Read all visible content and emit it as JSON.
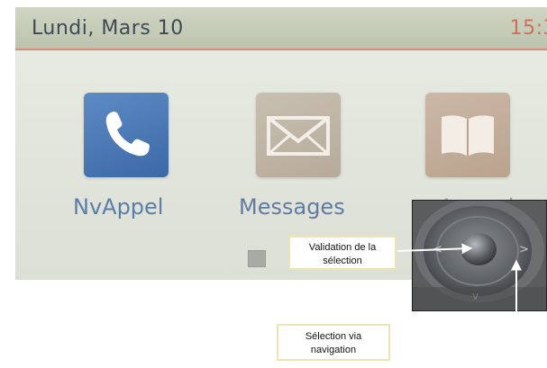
{
  "status_bar": {
    "date": "Lundi, Mars 10",
    "time": "15:3"
  },
  "apps": [
    {
      "label": "NvAppel",
      "icon": "phone-icon",
      "color": "#3b69a6"
    },
    {
      "label": "Messages",
      "icon": "envelope-icon",
      "color": "#b6ab9b"
    },
    {
      "label": "Annuaire",
      "icon": "book-icon",
      "color": "#b9a38e"
    }
  ],
  "pager": {
    "current_page": 1
  },
  "callouts": {
    "validate": {
      "line1": "Validation de la",
      "line2": "sélection"
    },
    "navigate": {
      "line1": "Sélection via",
      "line2": "navigation"
    }
  }
}
